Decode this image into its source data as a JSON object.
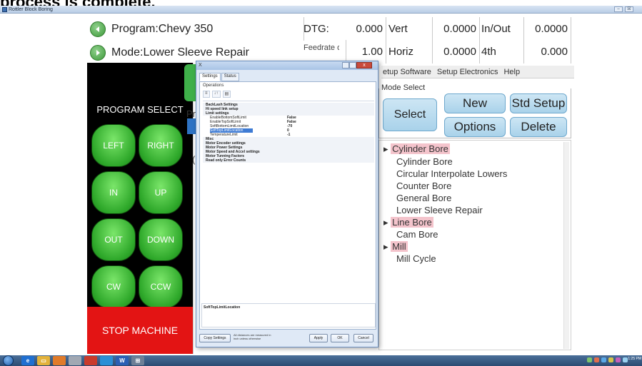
{
  "caption": "process is complete.",
  "window": {
    "title": "Rottler Block Boring",
    "min_label": "–",
    "close_label": "☒"
  },
  "status": {
    "program_label": "Program:Chevy 350",
    "mode_label": "Mode:Lower Sleeve Repair",
    "dtg_label": "DTG:",
    "dtg_value": "0.000",
    "feedrate_label": "Feedrate override",
    "feedrate_value": "1.00",
    "vert_label": "Vert",
    "vert_value": "0.0000",
    "horiz_label": "Horiz",
    "horiz_value": "0.0000",
    "inout_label": "In/Out",
    "inout_value": "0.0000",
    "fourth_label": "4th",
    "fourth_value": "0.000"
  },
  "panel": {
    "title": "PROGRAM SELECT",
    "buttons": [
      "LEFT",
      "RIGHT",
      "IN",
      "UP",
      "OUT",
      "DOWN",
      "CW",
      "CCW"
    ],
    "stop_label": "STOP MACHINE",
    "partial_label_1": "Pr",
    "partial_label_2": "("
  },
  "menu": {
    "items": [
      "etup Software",
      "Setup Electronics",
      "Help"
    ]
  },
  "mode_select": {
    "label": "Mode Select",
    "select_label": "Select",
    "new_label": "New",
    "std_setup_label": "Std Setup",
    "options_label": "Options",
    "delete_label": "Delete"
  },
  "tree": {
    "items": [
      {
        "label": "Cylinder Bore",
        "category": true
      },
      {
        "label": "Cylinder Bore",
        "category": false
      },
      {
        "label": "Circular Interpolate Lowers",
        "category": false
      },
      {
        "label": "Counter Bore",
        "category": false
      },
      {
        "label": "General Bore",
        "category": false
      },
      {
        "label": "Lower Sleeve Repair",
        "category": false
      },
      {
        "label": "Line Bore",
        "category": true
      },
      {
        "label": "Cam Bore",
        "category": false
      },
      {
        "label": "Mill",
        "category": true
      },
      {
        "label": "Mill Cycle",
        "category": false
      }
    ]
  },
  "dialog": {
    "title": "X",
    "close_label": "x",
    "tabs": [
      "Settings",
      "Status"
    ],
    "header": "Operations",
    "toolbar": [
      "≡",
      "↓↑",
      "▤"
    ],
    "rows": [
      {
        "key": "BackLash Settings",
        "value": "",
        "group": true
      },
      {
        "key": "Hi speed link setup",
        "value": "",
        "group": true
      },
      {
        "key": "Limit settings",
        "value": "",
        "group": true
      },
      {
        "key": "EnableBottomSoftLimit",
        "value": "False",
        "group": false
      },
      {
        "key": "EnableTopSoftLimit",
        "value": "False",
        "group": false
      },
      {
        "key": "SoftBottomLimitLocation",
        "value": "-70",
        "group": false
      },
      {
        "key": "SoftTopLimitLocation",
        "value": "0",
        "group": false,
        "selected": true
      },
      {
        "key": "TemperatureLimit",
        "value": "-1",
        "group": false
      },
      {
        "key": "Misc",
        "value": "",
        "group": true
      },
      {
        "key": "Motor Encoder settings",
        "value": "",
        "group": true
      },
      {
        "key": "Motor Power Settings",
        "value": "",
        "group": true
      },
      {
        "key": "Motor Speed and Accel settings",
        "value": "",
        "group": true
      },
      {
        "key": "Motor Tunning Factors",
        "value": "",
        "group": true
      },
      {
        "key": "Read only Error Counts",
        "value": "",
        "group": true
      }
    ],
    "description": "SoftTopLimitLocation",
    "footer": {
      "copy_label": "Copy Settings",
      "note": "All distances are measured in inch unless otherwise",
      "apply_label": "Apply",
      "ok_label": "OK",
      "cancel_label": "Cancel"
    }
  },
  "taskbar": {
    "items": [
      "e",
      "▭",
      "W",
      "⊞"
    ],
    "clock": "1:25 PM"
  },
  "colors": {
    "accent_green": "#3e9a3a",
    "stop_red": "#e31414",
    "category_pink": "#f4c4cc",
    "button_blue": "#a9d2ea"
  }
}
